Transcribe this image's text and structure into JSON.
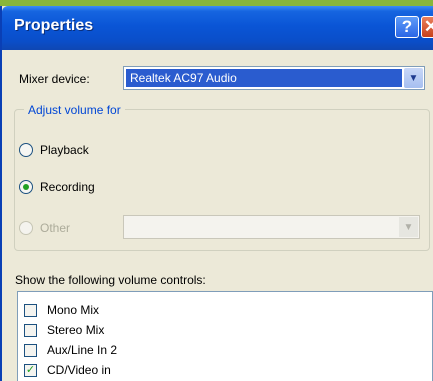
{
  "window": {
    "title": "Properties",
    "help_glyph": "?",
    "close_glyph": "✕"
  },
  "mixer": {
    "label": "Mixer device:",
    "value": "Realtek AC97 Audio"
  },
  "adjust": {
    "legend": "Adjust volume for",
    "options": [
      {
        "label": "Playback",
        "checked": false,
        "enabled": true
      },
      {
        "label": "Recording",
        "checked": true,
        "enabled": true
      },
      {
        "label": "Other",
        "checked": false,
        "enabled": false
      }
    ],
    "other_select_value": ""
  },
  "controls": {
    "label": "Show the following volume controls:",
    "items": [
      {
        "label": "Mono Mix",
        "checked": false
      },
      {
        "label": "Stereo Mix",
        "checked": false
      },
      {
        "label": "Aux/Line In 2",
        "checked": false
      },
      {
        "label": "CD/Video in",
        "checked": true
      }
    ],
    "check_glyph": "✓"
  },
  "colors": {
    "titlebar": "#0a55d6",
    "selection": "#2a5ccf",
    "group_legend": "#0046d5",
    "radio_dot": "#21a121",
    "dialog_bg": "#ece9d8",
    "backdrop": "#88b63a"
  },
  "icons": {
    "help": "help-icon",
    "close": "close-icon",
    "dropdown": "chevron-down-icon",
    "check": "check-icon"
  }
}
